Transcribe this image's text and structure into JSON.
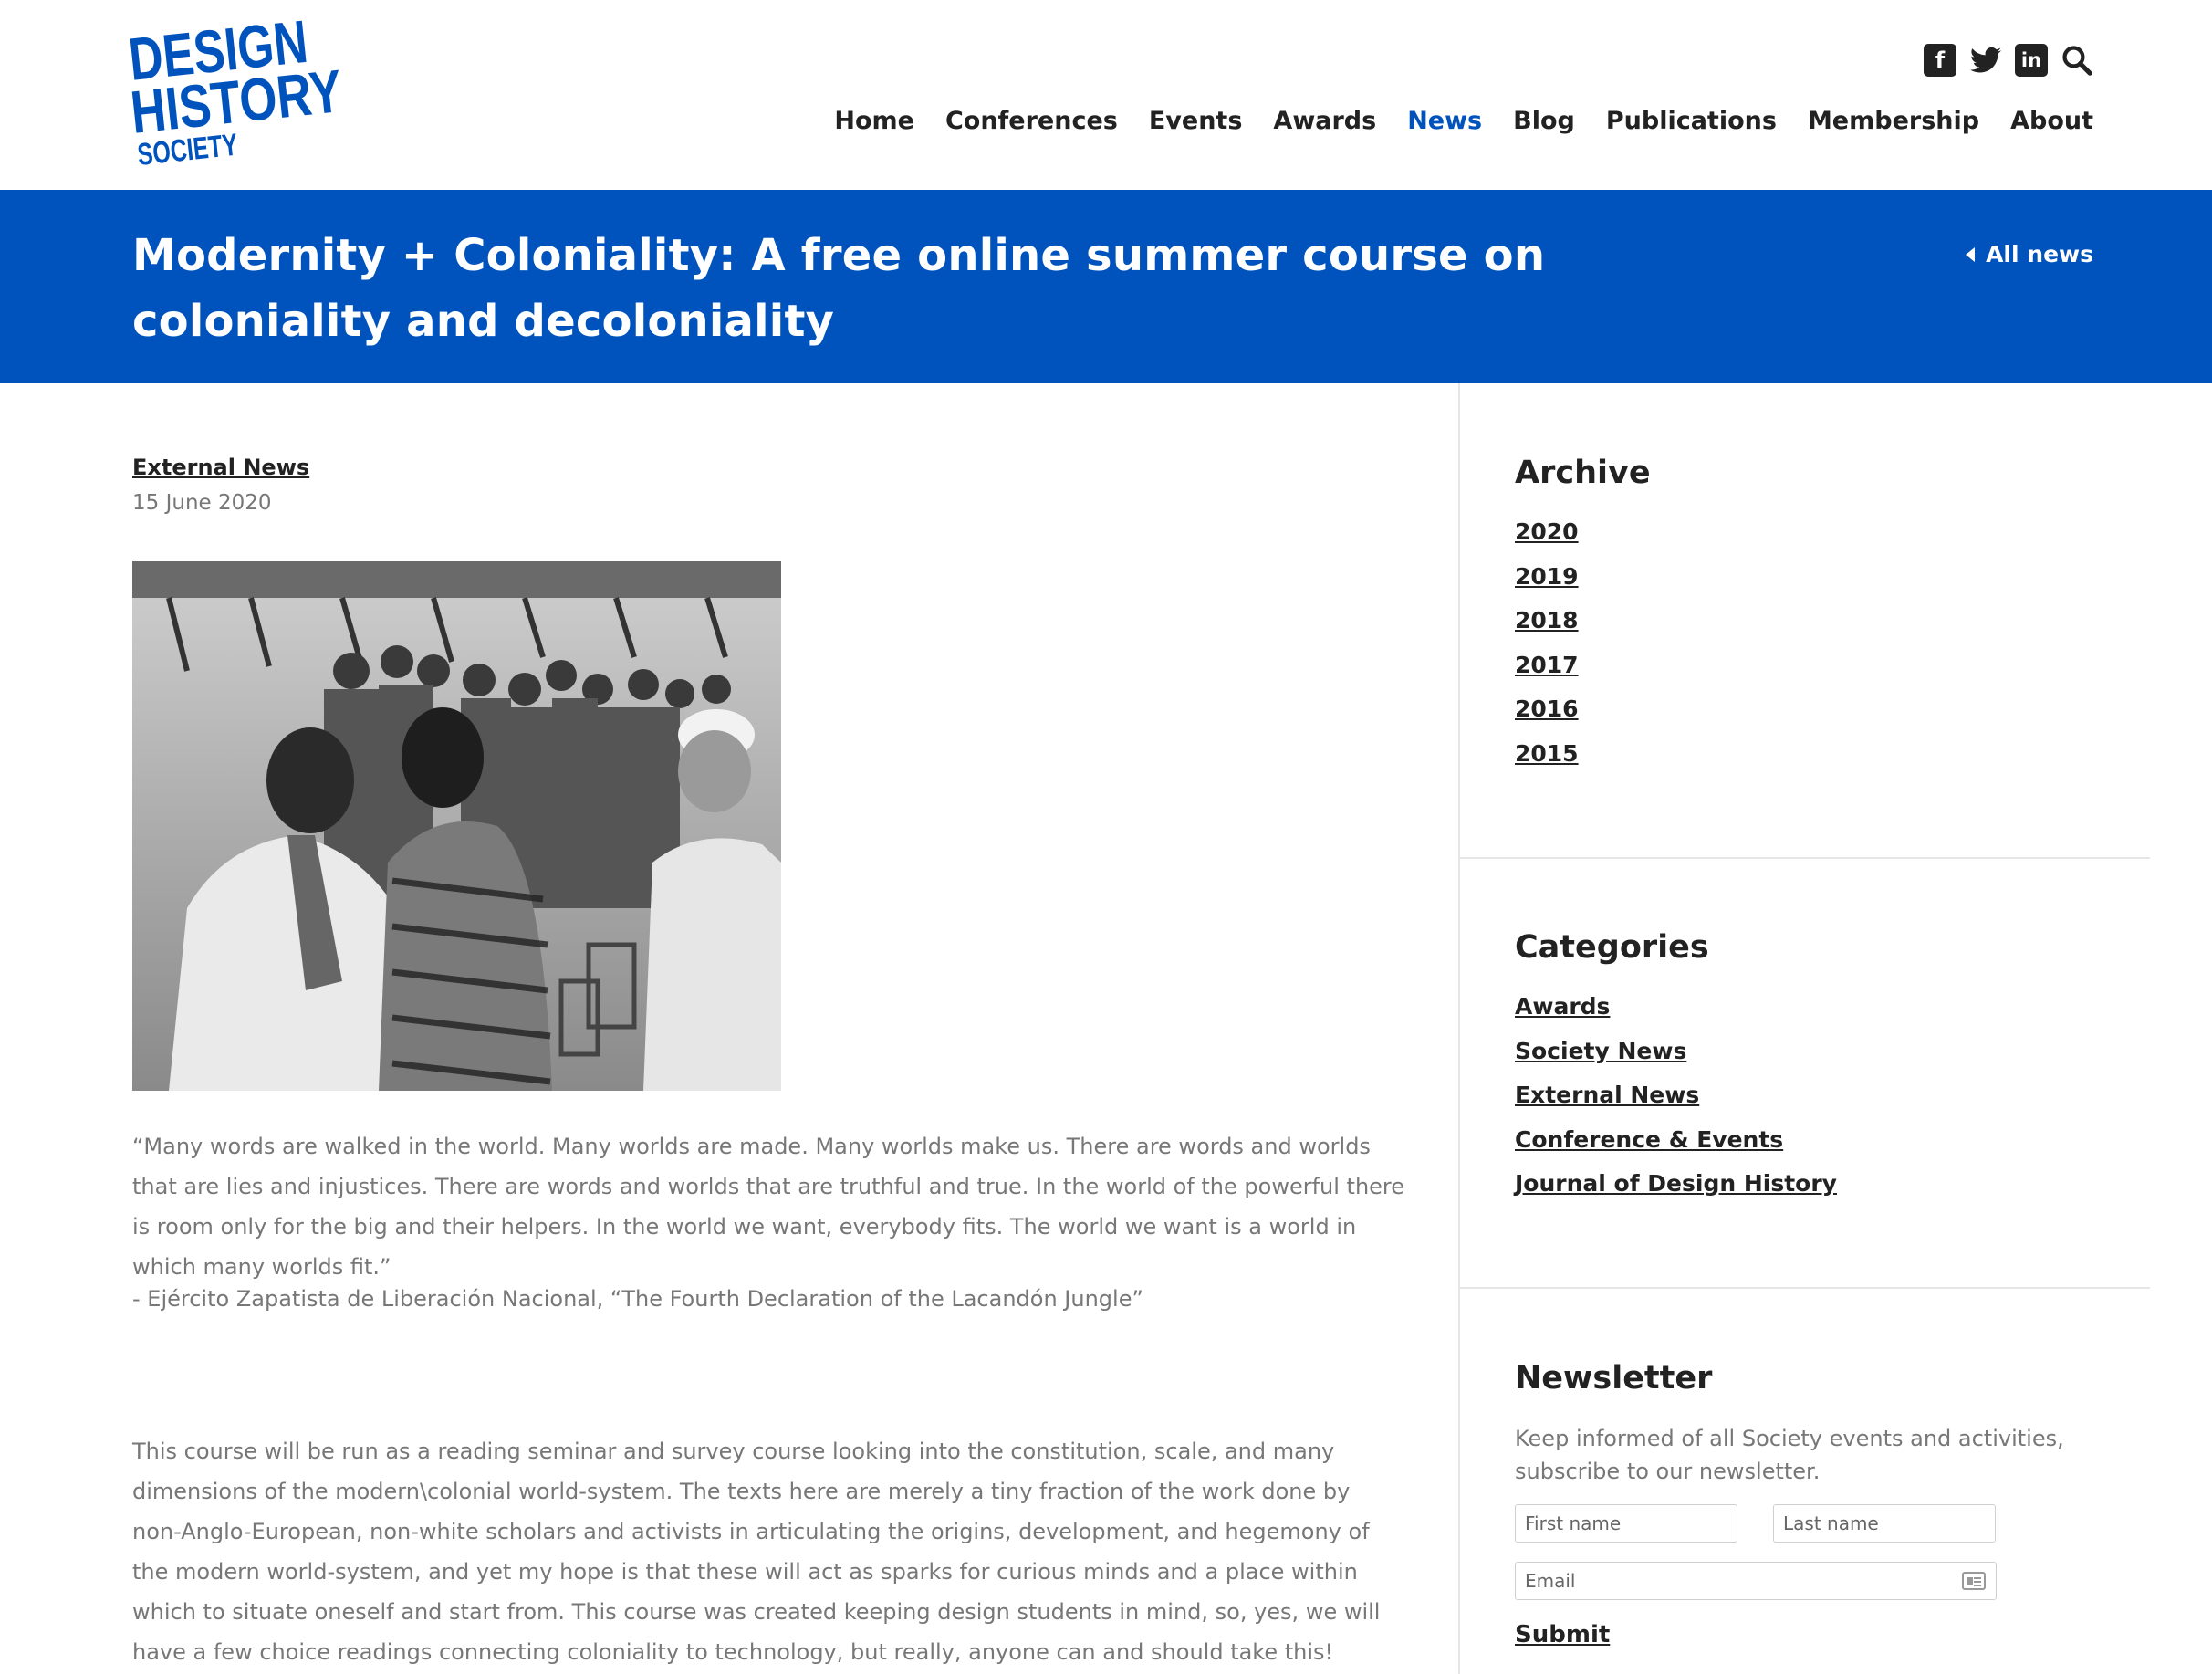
{
  "header": {
    "logo": {
      "line1": "DESIGN",
      "line2": "HISTORY",
      "line3": "SOCIETY",
      "color": "#0053bd"
    },
    "social": [
      {
        "icon": "facebook-icon",
        "glyph": "f"
      },
      {
        "icon": "twitter-icon",
        "glyph": ""
      },
      {
        "icon": "linkedin-icon",
        "glyph": "in"
      },
      {
        "icon": "search-icon",
        "glyph": ""
      }
    ],
    "nav": [
      "Home",
      "Conferences",
      "Events",
      "Awards",
      "News",
      "Blog",
      "Publications",
      "Membership",
      "About"
    ],
    "active_nav": "News"
  },
  "title_band": {
    "title": "Modernity + Coloniality: A free online summer course on coloniality and decoloniality",
    "back_link": "All news",
    "background": "#0053bd"
  },
  "article": {
    "category": "External News",
    "date": "15 June 2020",
    "quote": "“Many words are walked in the world. Many worlds are made. Many worlds make us. There are words and worlds that are lies and injustices. There are words and worlds that are truthful and true. In the world of the powerful there is room only for the big and their helpers. In the world we want, everybody fits. The world we want is a world in which many worlds fit.”",
    "attribution": "- Ejército Zapatista de Liberación Nacional, “The Fourth Declaration of the Lacandón Jungle”",
    "body": "This course will be run as a reading seminar and survey course looking into the constitution, scale, and many dimensions of the modern\\colonial world-system. The texts here are merely a tiny fraction of the work done by non-Anglo-European, non-white scholars and activists in articulating the origins, development, and hegemony of the modern world-system, and yet my hope is that these will act as sparks for curious minds and a place within which to situate oneself and start from. This course was created keeping design students in mind, so, yes, we will have a few choice readings connecting coloniality to technology, but really, anyone can and should take this!"
  },
  "sidebar": {
    "archive": {
      "heading": "Archive",
      "years": [
        "2020",
        "2019",
        "2018",
        "2017",
        "2016",
        "2015"
      ]
    },
    "categories": {
      "heading": "Categories",
      "items": [
        "Awards",
        "Society News",
        "External News",
        "Conference & Events",
        "Journal of Design History"
      ]
    },
    "newsletter": {
      "heading": "Newsletter",
      "text": "Keep informed of all Society events and activities, subscribe to our newsletter.",
      "first_name_placeholder": "First name",
      "last_name_placeholder": "Last name",
      "email_placeholder": "Email",
      "submit": "Submit"
    }
  }
}
